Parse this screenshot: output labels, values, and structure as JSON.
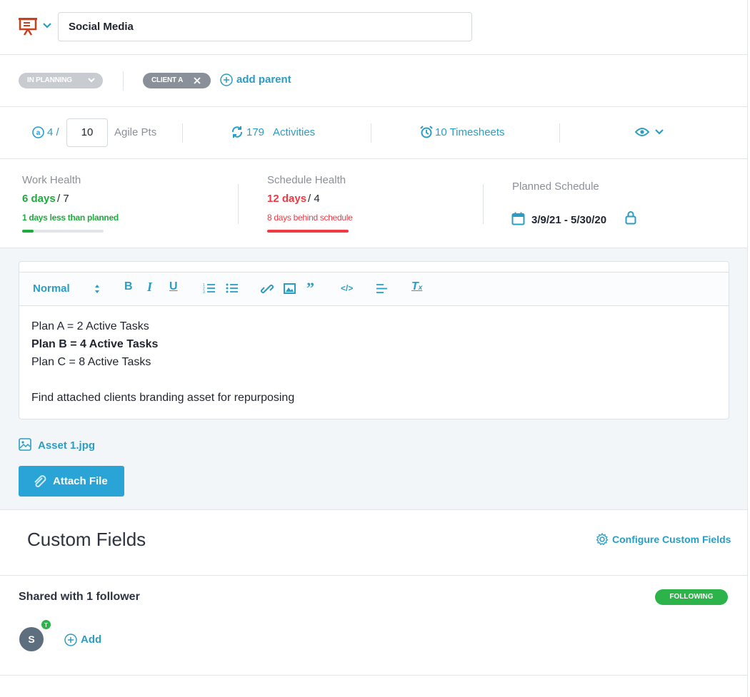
{
  "header": {
    "title_value": "Social Media"
  },
  "tags": {
    "status_label": "IN PLANNING",
    "client_label": "CLIENT A",
    "add_parent_label": "add parent"
  },
  "metrics": {
    "points_done": "4 /",
    "points_total": "10",
    "points_unit": "Agile Pts",
    "activities_count": "179",
    "activities_label": "Activities",
    "timesheets_label": "10 Timesheets"
  },
  "health": {
    "work_label": "Work Health",
    "work_days": "6 days",
    "work_total": "/ 7",
    "work_note": "1 days less than planned",
    "work_progress": 0.14,
    "schedule_label": "Schedule Health",
    "schedule_days": "12 days",
    "schedule_total": "/ 4",
    "schedule_note": "8 days behind schedule",
    "schedule_progress": 1.0,
    "planned_label": "Planned Schedule",
    "planned_range": "3/9/21 - 5/30/20"
  },
  "editor": {
    "format_label": "Normal",
    "lines": [
      "Plan A = 2 Active Tasks",
      "Plan B = 4 Active Tasks",
      "Plan C = 8 Active Tasks",
      "Find attached clients branding asset for repurposing"
    ]
  },
  "attachments": {
    "file_name": "Asset 1.jpg",
    "attach_label": "Attach File"
  },
  "custom_fields": {
    "title": "Custom Fields",
    "configure_label": "Configure Custom Fields"
  },
  "followers": {
    "title": "Shared with 1 follower",
    "following_label": "FOLLOWING",
    "avatar_initial": "S",
    "avatar_badge": "T",
    "add_label": "Add"
  },
  "colors": {
    "accent": "#2a9dc4",
    "success": "#1eaa3c",
    "danger": "#f03a43",
    "button": "#2aa3d6",
    "presentation_icon": "#c8401e"
  }
}
